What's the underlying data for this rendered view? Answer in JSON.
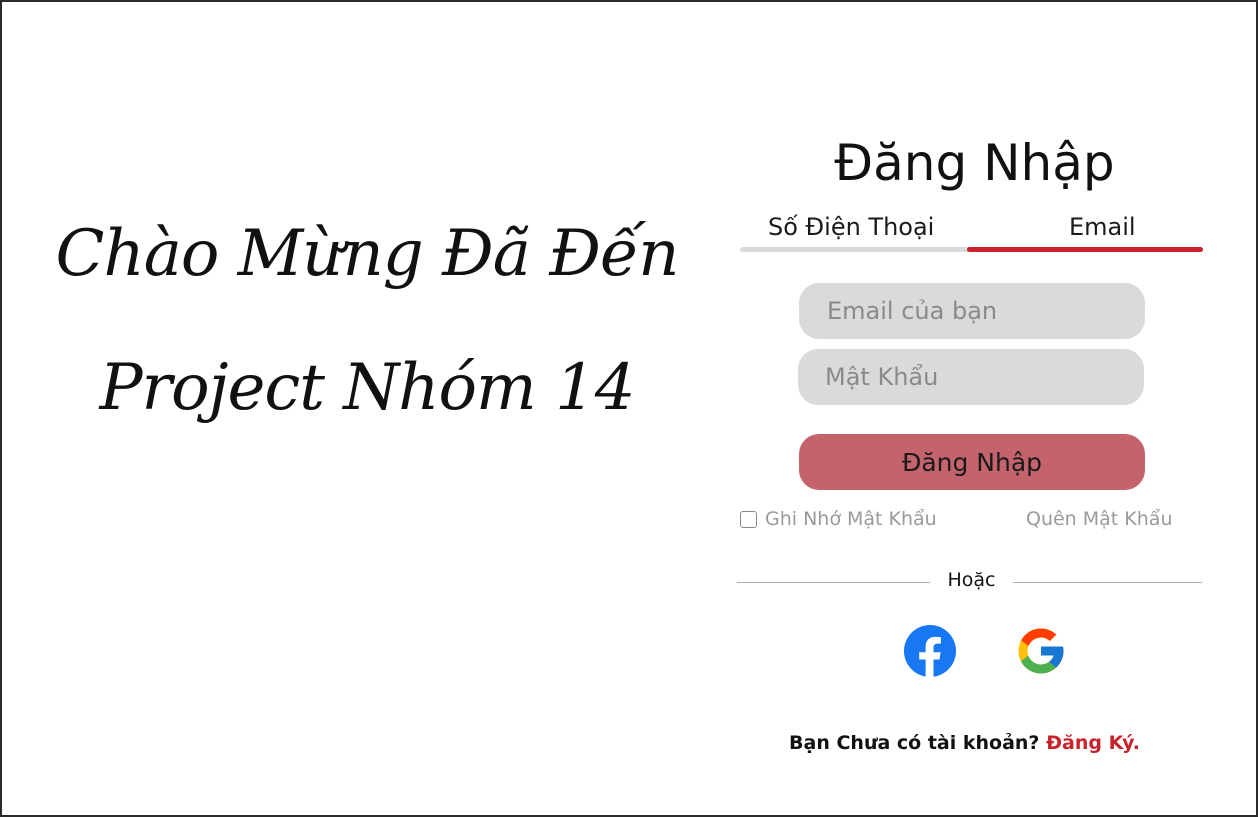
{
  "welcome": {
    "line1": "Chào Mừng Đã Đến",
    "line2": "Project Nhóm 14"
  },
  "login": {
    "title": "Đăng Nhập",
    "tabs": [
      {
        "label": "Số Điện Thoại",
        "active": false
      },
      {
        "label": "Email",
        "active": true
      }
    ],
    "email_placeholder": "Email của bạn",
    "password_placeholder": "Mật Khẩu",
    "submit_label": "Đăng Nhập",
    "remember_label": "Ghi Nhớ Mật Khẩu",
    "remember_checked": false,
    "forgot_label": "Quên Mật Khẩu",
    "divider_text": "Hoặc",
    "social": [
      {
        "icon": "facebook-icon",
        "color": "#1877f2"
      },
      {
        "icon": "google-icon"
      }
    ],
    "signup_prompt": "Bạn Chưa có tài khoản?",
    "signup_link": "Đăng Ký."
  },
  "colors": {
    "accent_red": "#c8232c",
    "button_bg": "#c5636d",
    "input_bg": "#dadada",
    "tab_inactive": "#d9d9d9"
  }
}
